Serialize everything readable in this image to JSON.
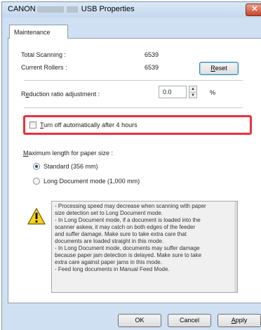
{
  "window": {
    "title_prefix": "CANON",
    "title_suffix": "USB Properties",
    "close_symbol": "✕"
  },
  "tabs": [
    {
      "label": "Maintenance"
    }
  ],
  "counters": {
    "total_scanning_label": "Total Scanning :",
    "total_scanning_value": "6539",
    "current_rollers_label": "Current Rollers :",
    "current_rollers_value": "6539",
    "reset_label": "Reset",
    "reset_underline": "R",
    "reset_rest": "eset"
  },
  "reduction": {
    "label_pre": "R",
    "label_underline": "e",
    "label_post": "duction ratio adjustment :",
    "value": "0.0",
    "unit": "%"
  },
  "auto_off": {
    "underline": "T",
    "label_rest": "urn off automatically after 4 hours",
    "checked": false
  },
  "paper_size": {
    "heading_underline": "M",
    "heading_rest": "aximum length for paper size :",
    "options": [
      {
        "label": "Standard (356 mm)",
        "selected": true
      },
      {
        "label": "Long Document mode (1,000 mm)",
        "selected": false
      }
    ]
  },
  "notice": {
    "icon": "warning-icon",
    "lines": [
      "- Processing speed may decrease when scanning with paper",
      "size detection set to Long Document mode.",
      "- In Long Document mode, if a document is loaded into the",
      "scanner askew, it may catch on both edges of the feeder",
      "and suffer damage. Make sure to take extra care that",
      "documents are loaded straight in this mode.",
      "- In Long Document mode, documents may suffer damage",
      "because paper jam detection is delayed. Make sure to take",
      "extra care against paper jams in this mode.",
      "- Feed long documents in Manual Feed Mode."
    ]
  },
  "footer": {
    "ok": "OK",
    "cancel": "Cancel",
    "apply_underline": "A",
    "apply_rest": "pply"
  },
  "colors": {
    "highlight": "#e8323c",
    "warning_yellow": "#f6d21a",
    "window_frame": "#cfe0f2"
  }
}
